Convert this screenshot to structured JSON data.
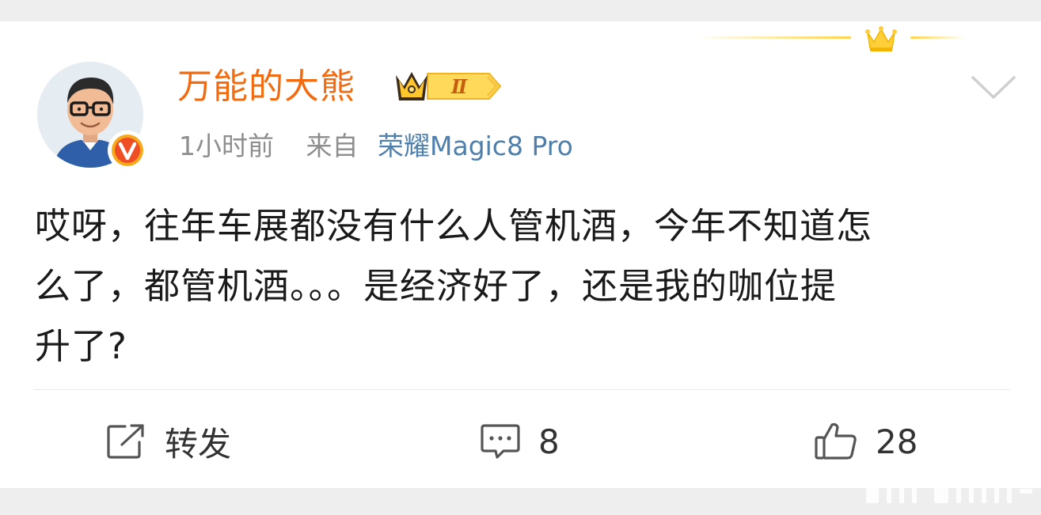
{
  "post": {
    "author": {
      "name": "万能的大熊",
      "verified_badge": "V",
      "level_badge": "Ⅱ"
    },
    "meta": {
      "time": "1小时前",
      "from_label": "来自",
      "device": "荣耀Magic8 Pro"
    },
    "text_lines": [
      "哎呀，往年车展都没有什么人管机酒，今年不知道怎",
      "么了，都管机酒。。。是经济好了，还是我的咖位提",
      "升了?"
    ],
    "actions": {
      "repost_label": "转发",
      "comment_count": "8",
      "like_count": "28"
    }
  },
  "icons": {
    "crown": "crown-icon",
    "more": "chevron-down-icon",
    "repost": "repost-icon",
    "comment": "comment-icon",
    "like": "thumbs-up-icon"
  },
  "colors": {
    "author_name": "#f26b11",
    "device_link": "#4f7fab",
    "meta_text": "#8e8e8e",
    "body_text": "#1a1a1a",
    "background": "#eeeeee"
  }
}
